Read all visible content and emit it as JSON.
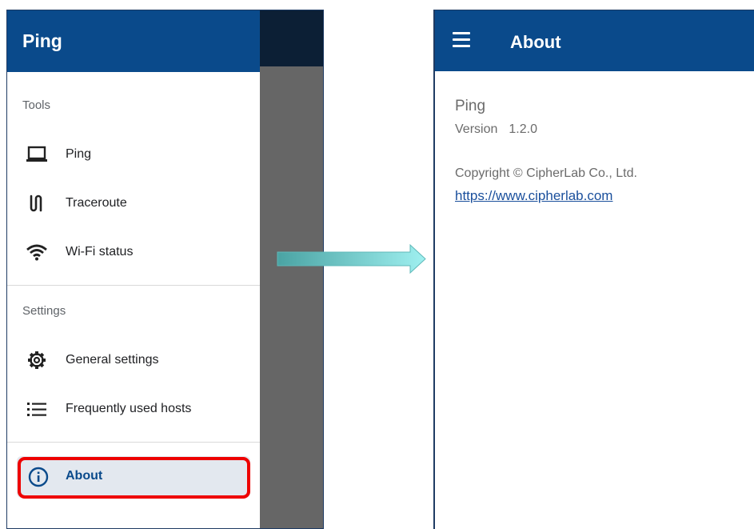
{
  "drawer": {
    "header_title": "Ping",
    "sections": [
      {
        "title": "Tools",
        "items": [
          {
            "label": "Ping",
            "icon": "laptop-icon"
          },
          {
            "label": "Traceroute",
            "icon": "route-icon"
          },
          {
            "label": "Wi-Fi status",
            "icon": "wifi-icon"
          }
        ]
      },
      {
        "title": "Settings",
        "items": [
          {
            "label": "General settings",
            "icon": "gear-icon"
          },
          {
            "label": "Frequently used hosts",
            "icon": "list-icon"
          }
        ]
      }
    ],
    "about_item": {
      "label": "About",
      "icon": "info-icon",
      "selected": true
    }
  },
  "about_screen": {
    "appbar": {
      "title": "About",
      "menu_icon": "hamburger-icon"
    },
    "app_name": "Ping",
    "version_label": "Version",
    "version_value": "1.2.0",
    "copyright": "Copyright © CipherLab Co., Ltd.",
    "website": "https://www.cipherlab.com"
  },
  "colors": {
    "primary": "#0a4a8b",
    "highlight": "#ee0000",
    "arrow": "#7fd6d6",
    "scrim": "#666666"
  }
}
